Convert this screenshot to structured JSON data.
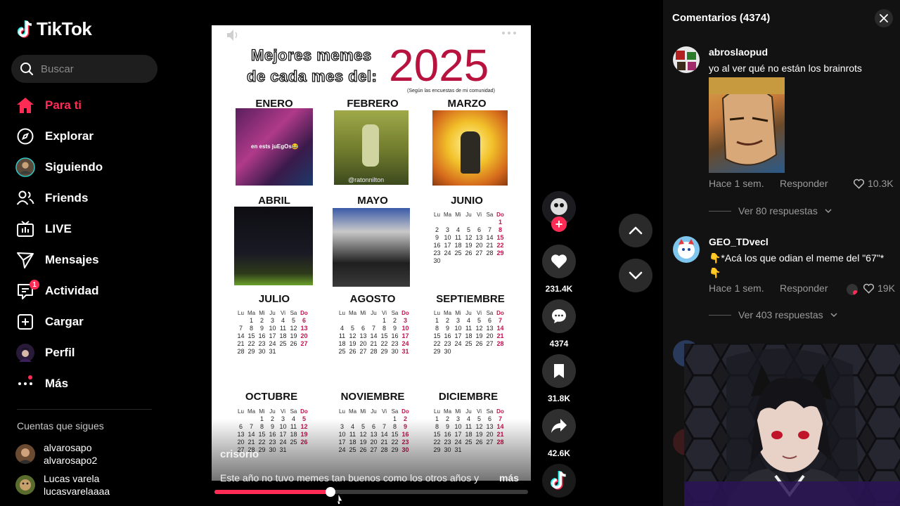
{
  "app": {
    "name": "TikTok"
  },
  "search": {
    "placeholder": "Buscar"
  },
  "nav": [
    {
      "label": "Para ti",
      "icon": "home-icon",
      "active": true
    },
    {
      "label": "Explorar",
      "icon": "compass-icon"
    },
    {
      "label": "Siguiendo",
      "icon": "avatar-icon"
    },
    {
      "label": "Friends",
      "icon": "friends-icon"
    },
    {
      "label": "LIVE",
      "icon": "live-icon"
    },
    {
      "label": "Mensajes",
      "icon": "send-icon"
    },
    {
      "label": "Actividad",
      "icon": "activity-icon",
      "badge": "1"
    },
    {
      "label": "Cargar",
      "icon": "upload-icon"
    },
    {
      "label": "Perfil",
      "icon": "profile-icon"
    },
    {
      "label": "Más",
      "icon": "more-icon"
    }
  ],
  "following": {
    "title": "Cuentas que sigues",
    "accounts": [
      {
        "name": "alvarosapo",
        "handle": "alvarosapo2"
      },
      {
        "name": "Lucas varela",
        "handle": "lucasvarelaaaa"
      }
    ]
  },
  "video": {
    "title_line1": "Mejores memes",
    "title_line2": "de cada mes del:",
    "year": "2025",
    "subtitle": "(Según las encuestas de mi comunidad)",
    "months": [
      "ENERO",
      "FEBRERO",
      "MARZO",
      "ABRIL",
      "MAYO",
      "JUNIO",
      "JULIO",
      "AGOSTO",
      "SEPTIEMBRE",
      "OCTUBRE",
      "NOVIEMBRE",
      "DICIEMBRE"
    ],
    "meme_captions": {
      "enero": "en ests juEgOs😂",
      "febrero": "@ratonnilton"
    },
    "weekday_headers": [
      "Lu",
      "Ma",
      "Mi",
      "Ju",
      "Vi",
      "Sa",
      "Do"
    ],
    "author": "crisorio",
    "caption": "Este año no tuvo memes tan buenos como los otros años y",
    "more_label": "más",
    "progress": 0.37
  },
  "actions": {
    "likes": "231.4K",
    "comments": "4374",
    "saves": "31.8K",
    "shares": "42.6K"
  },
  "comments_panel": {
    "title": "Comentarios (4374)",
    "items": [
      {
        "user": "abroslaopud",
        "text": "yo al ver qué no están los brainrots",
        "time": "Hace 1 sem.",
        "reply": "Responder",
        "likes": "10.3K",
        "replies": "Ver 80 respuestas"
      },
      {
        "user": "GEO_TDvecl",
        "text": "👇*Acá los que odian el meme del \"67\"* 👇",
        "time": "Hace 1 sem.",
        "reply": "Responder",
        "likes": "19K",
        "replies": "Ver 403 respuestas"
      }
    ]
  },
  "colors": {
    "accent": "#fe2c55",
    "panel": "#121212",
    "calendar_red": "#c4124a"
  }
}
